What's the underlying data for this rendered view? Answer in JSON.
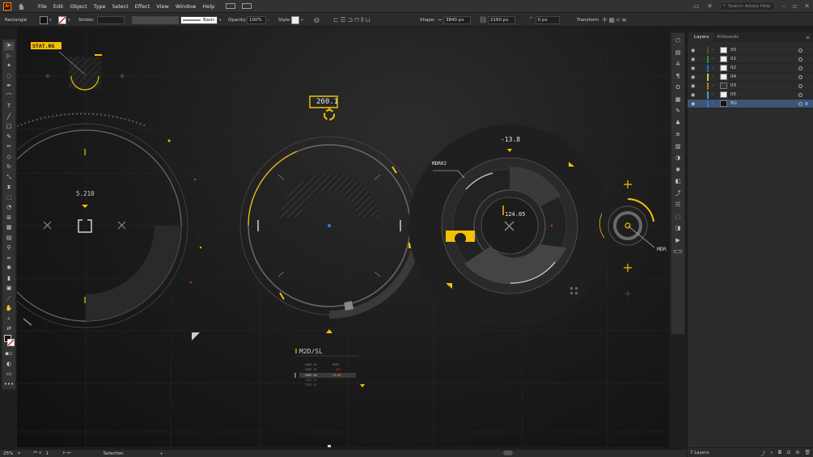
{
  "menubar": {
    "app_logo": "Ai",
    "items": [
      "File",
      "Edit",
      "Object",
      "Type",
      "Select",
      "Effect",
      "View",
      "Window",
      "Help"
    ],
    "search_placeholder": "Search Adobe Help"
  },
  "controlbar": {
    "object_type": "Rectangle",
    "stroke_label": "Stroke:",
    "brush_label": "Basic",
    "opacity_label": "Opacity:",
    "opacity_value": "100%",
    "style_label": "Style:",
    "shape_label": "Shape:",
    "width_value": "3840 px",
    "height_value": "2160 px",
    "corner_value": "0 px",
    "transform_label": "Transform"
  },
  "hud": {
    "stat_rg": "STAT.RG",
    "readout_top": "260.1",
    "left_value": "5.210",
    "right_label": "MDR02",
    "right_top_value": "-13.8",
    "center_value": "124.05",
    "far_right_label": "MDR",
    "m2d_title": "M2D/SL",
    "m2d_rows": [
      [
        "CORE 01",
        "PASS"
      ],
      [
        "CORE 02",
        "-.091"
      ],
      [
        "CORE 03",
        "72.8%"
      ],
      [
        "CORE 04",
        ""
      ],
      [
        "CORE 05",
        ""
      ]
    ]
  },
  "layers_panel": {
    "tabs": [
      "Layers",
      "Artboards"
    ],
    "layers": [
      {
        "name": "00",
        "color": "#4a4a4a"
      },
      {
        "name": "01",
        "color": "#2f8a3a"
      },
      {
        "name": "02",
        "color": "#1e6bd6"
      },
      {
        "name": "04",
        "color": "#d4c82a"
      },
      {
        "name": "03",
        "color": "#c86a2a"
      },
      {
        "name": "05",
        "color": "#3aa0d8"
      },
      {
        "name": "BG",
        "color": "#4a6ad0"
      }
    ],
    "count_label": "7 Layers"
  },
  "statusbar": {
    "zoom": "25%",
    "artboard_num": "1",
    "tool_name": "Selection"
  },
  "colors": {
    "accent_yellow": "#f5c000",
    "hud_line": "#6a6a6a",
    "selected_layer": "#3d5574"
  }
}
